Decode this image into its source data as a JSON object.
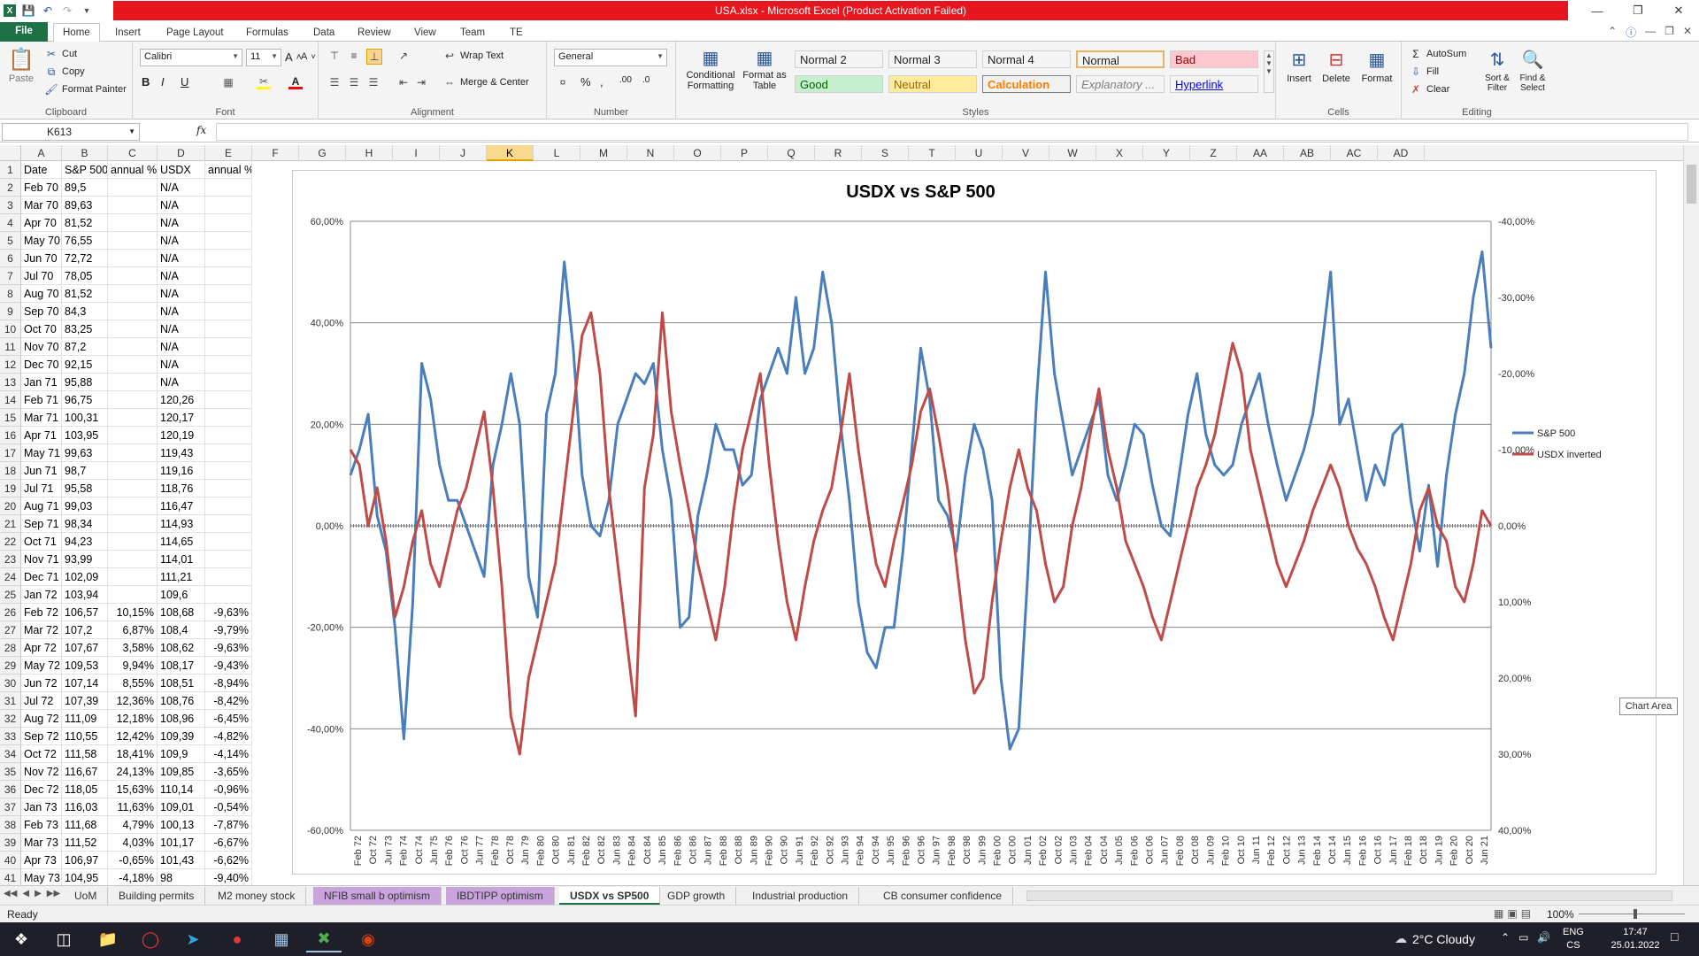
{
  "title_bar": {
    "title": "USA.xlsx - Microsoft Excel (Product Activation Failed)"
  },
  "ribbon_tabs": [
    "File",
    "Home",
    "Insert",
    "Page Layout",
    "Formulas",
    "Data",
    "Review",
    "View",
    "Team",
    "TE"
  ],
  "clipboard": {
    "paste": "Paste",
    "cut": "Cut",
    "copy": "Copy",
    "format_painter": "Format Painter",
    "label": "Clipboard"
  },
  "font": {
    "name": "Calibri",
    "size": "11",
    "label": "Font"
  },
  "alignment": {
    "wrap": "Wrap Text",
    "merge": "Merge & Center",
    "label": "Alignment"
  },
  "number": {
    "format": "General",
    "label": "Number"
  },
  "styles": {
    "conditional": "Conditional Formatting",
    "format_table": "Format as Table",
    "label": "Styles",
    "boxes": [
      {
        "text": "Normal 2",
        "bg": "#ffffff",
        "fg": "#000000"
      },
      {
        "text": "Normal 3",
        "bg": "#ffffff",
        "fg": "#000000"
      },
      {
        "text": "Normal 4",
        "bg": "#ffffff",
        "fg": "#000000"
      },
      {
        "text": "Normal",
        "bg": "#ffffff",
        "fg": "#000000"
      },
      {
        "text": "Bad",
        "bg": "#ffc7ce",
        "fg": "#9c0006"
      },
      {
        "text": "Good",
        "bg": "#c6efce",
        "fg": "#006100"
      },
      {
        "text": "Neutral",
        "bg": "#ffeb9c",
        "fg": "#9c6500"
      },
      {
        "text": "Calculation",
        "bg": "#f2f2f2",
        "fg": "#fa7d00"
      },
      {
        "text": "Explanatory ...",
        "bg": "#ffffff",
        "fg": "#7f7f7f"
      },
      {
        "text": "Hyperlink",
        "bg": "#ffffff",
        "fg": "#0000ff"
      }
    ]
  },
  "cells_group": {
    "insert": "Insert",
    "delete": "Delete",
    "format": "Format",
    "label": "Cells"
  },
  "editing": {
    "autosum": "AutoSum",
    "fill": "Fill",
    "clear": "Clear",
    "sort": "Sort & Filter",
    "find": "Find & Select",
    "label": "Editing"
  },
  "formula_bar": {
    "name_box": "K613",
    "fx": "fx",
    "value": ""
  },
  "columns": [
    "A",
    "B",
    "C",
    "D",
    "E",
    "F",
    "G",
    "H",
    "I",
    "J",
    "K",
    "L",
    "M",
    "N",
    "O",
    "P",
    "Q",
    "R",
    "S",
    "T",
    "U",
    "V",
    "W",
    "X",
    "Y",
    "Z",
    "AA",
    "AB",
    "AC",
    "AD"
  ],
  "selected_column": "K",
  "rows": [
    {
      "n": "1",
      "A": "Date",
      "B": "S&P 500",
      "C": "annual %",
      "D": "USDX",
      "E": "annual %"
    },
    {
      "n": "2",
      "A": "Feb 70",
      "B": "89,5",
      "C": "",
      "D": "N/A",
      "E": ""
    },
    {
      "n": "3",
      "A": "Mar 70",
      "B": "89,63",
      "C": "",
      "D": "N/A",
      "E": ""
    },
    {
      "n": "4",
      "A": "Apr 70",
      "B": "81,52",
      "C": "",
      "D": "N/A",
      "E": ""
    },
    {
      "n": "5",
      "A": "May 70",
      "B": "76,55",
      "C": "",
      "D": "N/A",
      "E": ""
    },
    {
      "n": "6",
      "A": "Jun 70",
      "B": "72,72",
      "C": "",
      "D": "N/A",
      "E": ""
    },
    {
      "n": "7",
      "A": "Jul 70",
      "B": "78,05",
      "C": "",
      "D": "N/A",
      "E": ""
    },
    {
      "n": "8",
      "A": "Aug 70",
      "B": "81,52",
      "C": "",
      "D": "N/A",
      "E": ""
    },
    {
      "n": "9",
      "A": "Sep 70",
      "B": "84,3",
      "C": "",
      "D": "N/A",
      "E": ""
    },
    {
      "n": "10",
      "A": "Oct 70",
      "B": "83,25",
      "C": "",
      "D": "N/A",
      "E": ""
    },
    {
      "n": "11",
      "A": "Nov 70",
      "B": "87,2",
      "C": "",
      "D": "N/A",
      "E": ""
    },
    {
      "n": "12",
      "A": "Dec 70",
      "B": "92,15",
      "C": "",
      "D": "N/A",
      "E": ""
    },
    {
      "n": "13",
      "A": "Jan 71",
      "B": "95,88",
      "C": "",
      "D": "N/A",
      "E": ""
    },
    {
      "n": "14",
      "A": "Feb 71",
      "B": "96,75",
      "C": "",
      "D": "120,26",
      "E": ""
    },
    {
      "n": "15",
      "A": "Mar 71",
      "B": "100,31",
      "C": "",
      "D": "120,17",
      "E": ""
    },
    {
      "n": "16",
      "A": "Apr 71",
      "B": "103,95",
      "C": "",
      "D": "120,19",
      "E": ""
    },
    {
      "n": "17",
      "A": "May 71",
      "B": "99,63",
      "C": "",
      "D": "119,43",
      "E": ""
    },
    {
      "n": "18",
      "A": "Jun 71",
      "B": "98,7",
      "C": "",
      "D": "119,16",
      "E": ""
    },
    {
      "n": "19",
      "A": "Jul 71",
      "B": "95,58",
      "C": "",
      "D": "118,76",
      "E": ""
    },
    {
      "n": "20",
      "A": "Aug 71",
      "B": "99,03",
      "C": "",
      "D": "116,47",
      "E": ""
    },
    {
      "n": "21",
      "A": "Sep 71",
      "B": "98,34",
      "C": "",
      "D": "114,93",
      "E": ""
    },
    {
      "n": "22",
      "A": "Oct 71",
      "B": "94,23",
      "C": "",
      "D": "114,65",
      "E": ""
    },
    {
      "n": "23",
      "A": "Nov 71",
      "B": "93,99",
      "C": "",
      "D": "114,01",
      "E": ""
    },
    {
      "n": "24",
      "A": "Dec 71",
      "B": "102,09",
      "C": "",
      "D": "111,21",
      "E": ""
    },
    {
      "n": "25",
      "A": "Jan 72",
      "B": "103,94",
      "C": "",
      "D": "109,6",
      "E": ""
    },
    {
      "n": "26",
      "A": "Feb 72",
      "B": "106,57",
      "C": "10,15%",
      "D": "108,68",
      "E": "-9,63%"
    },
    {
      "n": "27",
      "A": "Mar 72",
      "B": "107,2",
      "C": "6,87%",
      "D": "108,4",
      "E": "-9,79%"
    },
    {
      "n": "28",
      "A": "Apr 72",
      "B": "107,67",
      "C": "3,58%",
      "D": "108,62",
      "E": "-9,63%"
    },
    {
      "n": "29",
      "A": "May 72",
      "B": "109,53",
      "C": "9,94%",
      "D": "108,17",
      "E": "-9,43%"
    },
    {
      "n": "30",
      "A": "Jun 72",
      "B": "107,14",
      "C": "8,55%",
      "D": "108,51",
      "E": "-8,94%"
    },
    {
      "n": "31",
      "A": "Jul 72",
      "B": "107,39",
      "C": "12,36%",
      "D": "108,76",
      "E": "-8,42%"
    },
    {
      "n": "32",
      "A": "Aug 72",
      "B": "111,09",
      "C": "12,18%",
      "D": "108,96",
      "E": "-6,45%"
    },
    {
      "n": "33",
      "A": "Sep 72",
      "B": "110,55",
      "C": "12,42%",
      "D": "109,39",
      "E": "-4,82%"
    },
    {
      "n": "34",
      "A": "Oct 72",
      "B": "111,58",
      "C": "18,41%",
      "D": "109,9",
      "E": "-4,14%"
    },
    {
      "n": "35",
      "A": "Nov 72",
      "B": "116,67",
      "C": "24,13%",
      "D": "109,85",
      "E": "-3,65%"
    },
    {
      "n": "36",
      "A": "Dec 72",
      "B": "118,05",
      "C": "15,63%",
      "D": "110,14",
      "E": "-0,96%"
    },
    {
      "n": "37",
      "A": "Jan 73",
      "B": "116,03",
      "C": "11,63%",
      "D": "109,01",
      "E": "-0,54%"
    },
    {
      "n": "38",
      "A": "Feb 73",
      "B": "111,68",
      "C": "4,79%",
      "D": "100,13",
      "E": "-7,87%"
    },
    {
      "n": "39",
      "A": "Mar 73",
      "B": "111,52",
      "C": "4,03%",
      "D": "101,17",
      "E": "-6,67%"
    },
    {
      "n": "40",
      "A": "Apr 73",
      "B": "106,97",
      "C": "-0,65%",
      "D": "101,43",
      "E": "-6,62%"
    },
    {
      "n": "41",
      "A": "May 73",
      "B": "104,95",
      "C": "-4,18%",
      "D": "98",
      "E": "-9,40%"
    }
  ],
  "sheet_tabs": [
    {
      "name": "UoM",
      "style": "normal"
    },
    {
      "name": "Building permits",
      "style": "normal"
    },
    {
      "name": "M2 money stock",
      "style": "normal"
    },
    {
      "name": "NFIB small b optimism",
      "style": "purple"
    },
    {
      "name": "IBDTIPP optimism",
      "style": "purple"
    },
    {
      "name": "USDX vs SP500",
      "style": "active"
    },
    {
      "name": "GDP growth",
      "style": "normal"
    },
    {
      "name": "Industrial production",
      "style": "normal"
    },
    {
      "name": "CB consumer confidence",
      "style": "normal"
    }
  ],
  "status": {
    "ready": "Ready",
    "zoom": "100%"
  },
  "tooltip": "Chart Area",
  "taskbar": {
    "weather": "2°C  Cloudy",
    "lang": "ENG",
    "kb": "CS",
    "time": "17:47",
    "date": "25.01.2022"
  },
  "chart_data": {
    "type": "line",
    "title": "USDX vs S&P 500",
    "y_left": {
      "min": -0.6,
      "max": 0.6,
      "ticks": [
        "60,00%",
        "40,00%",
        "20,00%",
        "0,00%",
        "-20,00%",
        "-40,00%",
        "-60,00%"
      ]
    },
    "y_right": {
      "min": -0.4,
      "max": 0.4,
      "inverted": true,
      "ticks": [
        "-40,00%",
        "-30,00%",
        "-20,00%",
        "-10,00%",
        "0,00%",
        "10,00%",
        "20,00%",
        "30,00%",
        "40,00%"
      ]
    },
    "x_labels": [
      "Feb 72",
      "Oct 72",
      "Jun 73",
      "Feb 74",
      "Oct 74",
      "Jun 75",
      "Feb 76",
      "Oct 76",
      "Jun 77",
      "Feb 78",
      "Oct 78",
      "Jun 79",
      "Feb 80",
      "Oct 80",
      "Jun 81",
      "Feb 82",
      "Oct 82",
      "Jun 83",
      "Feb 84",
      "Oct 84",
      "Jun 85",
      "Feb 86",
      "Oct 86",
      "Jun 87",
      "Feb 88",
      "Oct 88",
      "Jun 89",
      "Feb 90",
      "Oct 90",
      "Jun 91",
      "Feb 92",
      "Oct 92",
      "Jun 93",
      "Feb 94",
      "Oct 94",
      "Jun 95",
      "Feb 96",
      "Oct 96",
      "Jun 97",
      "Feb 98",
      "Oct 98",
      "Jun 99",
      "Feb 00",
      "Oct 00",
      "Jun 01",
      "Feb 02",
      "Oct 02",
      "Jun 03",
      "Feb 04",
      "Oct 04",
      "Jun 05",
      "Feb 06",
      "Oct 06",
      "Jun 07",
      "Feb 08",
      "Oct 08",
      "Jun 09",
      "Feb 10",
      "Oct 10",
      "Jun 11",
      "Feb 12",
      "Oct 12",
      "Jun 13",
      "Feb 14",
      "Oct 14",
      "Jun 15",
      "Feb 16",
      "Oct 16",
      "Jun 17",
      "Feb 18",
      "Oct 18",
      "Jun 19",
      "Feb 20",
      "Oct 20",
      "Jun 21"
    ],
    "legend_position": "right",
    "series": [
      {
        "name": "S&P 500",
        "color": "#4a7ebb",
        "values": [
          0.1,
          0.15,
          0.22,
          0.02,
          -0.05,
          -0.2,
          -0.42,
          -0.15,
          0.32,
          0.25,
          0.12,
          0.05,
          0.05,
          0.0,
          -0.05,
          -0.1,
          0.12,
          0.2,
          0.3,
          0.2,
          -0.1,
          -0.18,
          0.22,
          0.3,
          0.52,
          0.35,
          0.1,
          0.0,
          -0.02,
          0.05,
          0.2,
          0.25,
          0.3,
          0.28,
          0.32,
          0.15,
          0.05,
          -0.2,
          -0.18,
          0.02,
          0.1,
          0.2,
          0.15,
          0.15,
          0.08,
          0.1,
          0.25,
          0.3,
          0.35,
          0.3,
          0.45,
          0.3,
          0.35,
          0.5,
          0.4,
          0.2,
          0.05,
          -0.15,
          -0.25,
          -0.28,
          -0.2,
          -0.2,
          -0.05,
          0.15,
          0.35,
          0.25,
          0.05,
          0.02,
          -0.05,
          0.1,
          0.2,
          0.15,
          0.05,
          -0.3,
          -0.44,
          -0.4,
          -0.1,
          0.25,
          0.5,
          0.3,
          0.2,
          0.1,
          0.15,
          0.2,
          0.25,
          0.1,
          0.05,
          0.12,
          0.2,
          0.18,
          0.08,
          0.0,
          -0.02,
          0.1,
          0.22,
          0.3,
          0.18,
          0.12,
          0.1,
          0.12,
          0.2,
          0.25,
          0.3,
          0.2,
          0.12,
          0.05,
          0.1,
          0.15,
          0.22,
          0.35,
          0.5,
          0.2,
          0.25,
          0.15,
          0.05,
          0.12,
          0.08,
          0.18,
          0.2,
          0.05,
          -0.05,
          0.08,
          -0.08,
          0.1,
          0.22,
          0.3,
          0.45,
          0.54,
          0.35
        ]
      },
      {
        "name": "USDX inverted",
        "color": "#be4b48",
        "values": [
          -0.1,
          -0.08,
          0.0,
          -0.05,
          0.02,
          0.12,
          0.08,
          0.02,
          -0.02,
          0.05,
          0.08,
          0.03,
          -0.02,
          -0.05,
          -0.1,
          -0.15,
          -0.05,
          0.08,
          0.25,
          0.3,
          0.2,
          0.15,
          0.1,
          0.05,
          -0.05,
          -0.15,
          -0.25,
          -0.28,
          -0.2,
          -0.05,
          0.05,
          0.15,
          0.25,
          -0.05,
          -0.12,
          -0.28,
          -0.15,
          -0.08,
          -0.02,
          0.05,
          0.1,
          0.15,
          0.08,
          -0.02,
          -0.1,
          -0.15,
          -0.2,
          -0.08,
          0.02,
          0.1,
          0.15,
          0.08,
          0.02,
          -0.02,
          -0.05,
          -0.12,
          -0.2,
          -0.1,
          -0.02,
          0.05,
          0.08,
          0.02,
          -0.03,
          -0.08,
          -0.15,
          -0.18,
          -0.12,
          -0.05,
          0.05,
          0.15,
          0.22,
          0.2,
          0.1,
          0.02,
          -0.05,
          -0.1,
          -0.05,
          -0.02,
          0.05,
          0.1,
          0.08,
          0.0,
          -0.05,
          -0.12,
          -0.18,
          -0.1,
          -0.05,
          0.02,
          0.05,
          0.08,
          0.12,
          0.15,
          0.1,
          0.05,
          0.0,
          -0.05,
          -0.08,
          -0.12,
          -0.18,
          -0.24,
          -0.2,
          -0.1,
          -0.05,
          0.0,
          0.05,
          0.08,
          0.05,
          0.02,
          -0.02,
          -0.05,
          -0.08,
          -0.05,
          0.0,
          0.03,
          0.05,
          0.08,
          0.12,
          0.15,
          0.1,
          0.05,
          -0.02,
          -0.05,
          0.0,
          0.02,
          0.08,
          0.1,
          0.05,
          -0.02,
          0.0
        ]
      }
    ]
  }
}
